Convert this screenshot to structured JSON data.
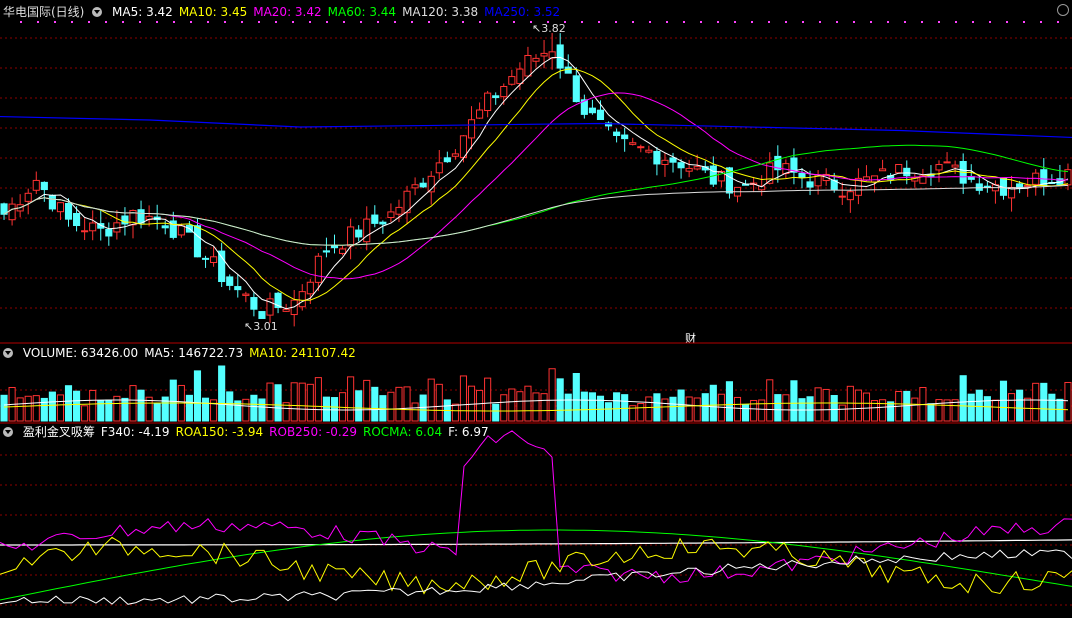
{
  "main": {
    "title": "华电国际(日线)",
    "ma_labels": [
      {
        "text": "MA5: 3.42",
        "color": "#ffffff"
      },
      {
        "text": "MA10: 3.45",
        "color": "#ffff00"
      },
      {
        "text": "MA20: 3.42",
        "color": "#ff00ff"
      },
      {
        "text": "MA60: 3.44",
        "color": "#00ff00"
      },
      {
        "text": "MA120: 3.38",
        "color": "#dddddd"
      },
      {
        "text": "MA250: 3.52",
        "color": "#0000ff"
      }
    ],
    "high_marker": "3.82",
    "low_marker": "3.01",
    "event_marker": "财"
  },
  "volume": {
    "labels": [
      {
        "text": "VOLUME: 63426.00",
        "color": "#ffffff"
      },
      {
        "text": "MA5: 146722.73",
        "color": "#ffffff"
      },
      {
        "text": "MA10: 241107.42",
        "color": "#ffff00"
      }
    ]
  },
  "indicator": {
    "labels": [
      {
        "text": "盈利金叉吸筹",
        "color": "#ffffff"
      },
      {
        "text": "F340: -4.19",
        "color": "#ffffff"
      },
      {
        "text": "ROA150: -3.94",
        "color": "#ffff00"
      },
      {
        "text": "ROB250: -0.29",
        "color": "#ff00ff"
      },
      {
        "text": "ROCMA: 6.04",
        "color": "#00ff00"
      },
      {
        "text": "F: 6.97",
        "color": "#ffffff"
      }
    ]
  },
  "chart_data": {
    "type": "candlestick",
    "price_range": [
      3.01,
      3.82
    ],
    "n_bars": 133,
    "colors": {
      "up": "#ff3232",
      "down": "#54ffff",
      "grid": "#8b0000",
      "divider": "#b40000"
    },
    "close_path_hint": [
      3.3,
      3.4,
      3.28,
      3.25,
      3.3,
      3.28,
      3.2,
      3.1,
      3.02,
      3.05,
      3.2,
      3.25,
      3.3,
      3.4,
      3.5,
      3.62,
      3.72,
      3.78,
      3.6,
      3.5,
      3.48,
      3.45,
      3.4,
      3.38,
      3.43,
      3.4,
      3.38,
      3.4,
      3.43,
      3.44,
      3.4,
      3.38,
      3.4,
      3.42
    ]
  }
}
